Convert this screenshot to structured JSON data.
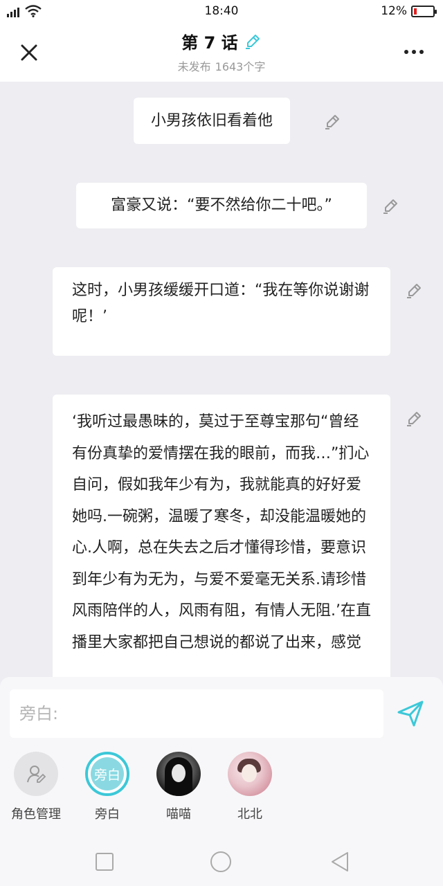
{
  "status_bar": {
    "time": "18:40",
    "battery": "12%"
  },
  "header": {
    "title": "第 7 话",
    "status": "未发布",
    "word_count": "1643个字"
  },
  "messages": [
    {
      "text": "小男孩依旧看着他"
    },
    {
      "text": "富豪又说：“要不然给你二十吧。”"
    },
    {
      "text": "这时，小男孩缓缓开口道：“我在等你说谢谢呢！’"
    },
    {
      "text": "‘我听过最愚昧的，莫过于至尊宝那句“曾经有份真挚的爱情摆在我的眼前，而我…”扪心自问，假如我年少有为，我就能真的好好爱她吗.一碗粥，温暖了寒冬，却没能温暖她的心.人啊，总在失去之后才懂得珍惜，要意识到年少有为无为，与爱不爱毫无关系.请珍惜风雨陪伴的人，风雨有阻，有情人无阻.’在直播里大家都把自己想说的都说了出来，感觉"
    }
  ],
  "composer": {
    "placeholder": "旁白:",
    "value": ""
  },
  "characters": [
    {
      "name": "角色管理"
    },
    {
      "name": "旁白",
      "avatar_text": "旁白",
      "selected": true
    },
    {
      "name": "喵喵"
    },
    {
      "name": "北北"
    }
  ],
  "colors": {
    "accent": "#3cc8d8",
    "background": "#ededf2",
    "bubble": "#ffffff"
  },
  "icons": {
    "close": "close-icon",
    "title_edit": "pen-edit-icon",
    "more": "more-dots-icon",
    "message_edit": "pen-edit-icon",
    "send": "send-icon",
    "manage": "person-edit-icon",
    "nav": [
      "square-recent-icon",
      "circle-home-icon",
      "triangle-back-icon"
    ]
  }
}
